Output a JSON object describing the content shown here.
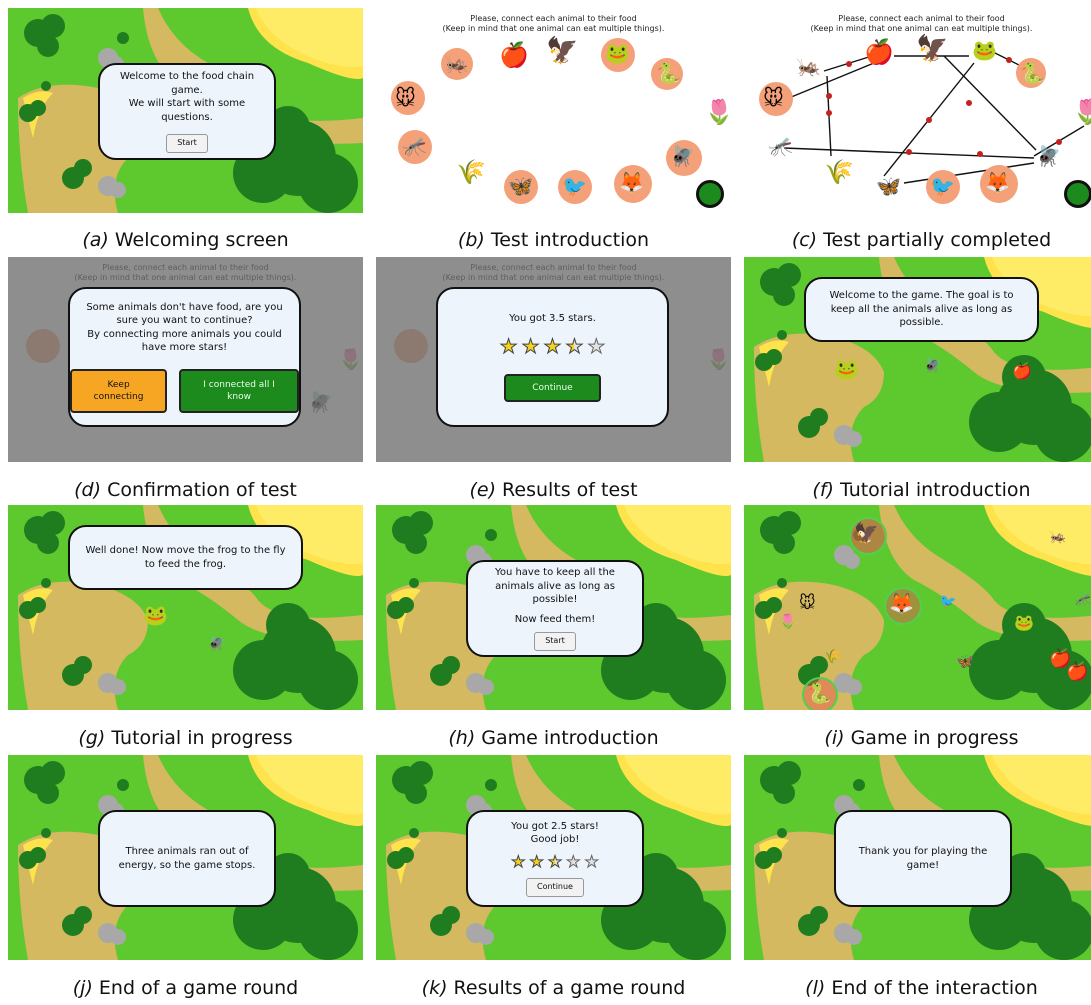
{
  "colors": {
    "grass": "#5ec82f",
    "path": "#d4b961",
    "sand": "#ffe34d",
    "bush": "#1f7d1f",
    "rock": "#a8a8a8",
    "dialog_bg": "#eef4fc",
    "animal_circle": "#f4a078",
    "dim_overlay": "#6e6e6e"
  },
  "test": {
    "instruction_line1": "Please, connect each animal to their food",
    "instruction_line2": "(Keep in mind that one animal can eat multiple things)."
  },
  "panels": {
    "a": {
      "caption_label": "(a)",
      "caption_text": "Welcoming screen",
      "dialog_text": "Welcome to the food chain game.\nWe will start with some questions.",
      "button_label": "Start"
    },
    "b": {
      "caption_label": "(b)",
      "caption_text": "Test introduction"
    },
    "c": {
      "caption_label": "(c)",
      "caption_text": "Test partially completed"
    },
    "d": {
      "caption_label": "(d)",
      "caption_text": "Confirmation of test",
      "dialog_text": "Some animals don't have food, are you sure you want to continue?\nBy connecting more animals you could have more stars!",
      "keep_label": "Keep connecting",
      "done_label": "I connected all I know"
    },
    "e": {
      "caption_label": "(e)",
      "caption_text": "Results of test",
      "dialog_text": "You got 3.5 stars.",
      "stars": 3.5,
      "button_label": "Continue"
    },
    "f": {
      "caption_label": "(f)",
      "caption_text": "Tutorial introduction",
      "dialog_text": "Welcome to the game. The goal is to keep all the animals alive as long as possible."
    },
    "g": {
      "caption_label": "(g)",
      "caption_text": "Tutorial in progress",
      "dialog_text": "Well done! Now move the frog to the fly to feed the frog."
    },
    "h": {
      "caption_label": "(h)",
      "caption_text": "Game introduction",
      "dialog_text": "You have to keep all the animals alive as long as possible!",
      "dialog_text2": "Now feed them!",
      "button_label": "Start"
    },
    "i": {
      "caption_label": "(i)",
      "caption_text": "Game in progress"
    },
    "j": {
      "caption_label": "(j)",
      "caption_text": "End of a game round",
      "dialog_text": "Three animals ran out of energy, so the game stops."
    },
    "k": {
      "caption_label": "(k)",
      "caption_text": "Results of a game round",
      "dialog_text": "You got 2.5 stars!\nGood job!",
      "stars": 2.5,
      "button_label": "Continue"
    },
    "l": {
      "caption_label": "(l)",
      "caption_text": "End of the interaction",
      "dialog_text": "Thank you for playing the game!"
    }
  },
  "icons": {
    "animals": [
      "mouse-icon",
      "grasshopper-icon",
      "eagle-icon",
      "frog-icon",
      "snake-icon",
      "dragonfly-icon",
      "butterfly-icon",
      "bird-icon",
      "fox-icon",
      "fly-icon"
    ],
    "foods": [
      "apple-icon",
      "wheat-icon",
      "tulip-icon"
    ]
  }
}
